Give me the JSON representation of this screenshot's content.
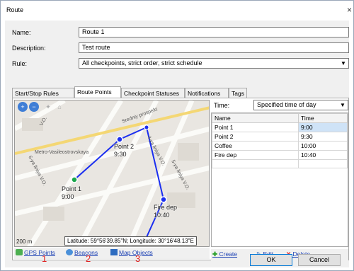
{
  "window": {
    "title": "Route",
    "close": "×"
  },
  "form": {
    "name_label": "Name:",
    "name_value": "Route 1",
    "description_label": "Description:",
    "description_value": "Test route",
    "rule_label": "Rule:",
    "rule_value": "All checkpoints, strict order, strict schedule"
  },
  "tabs": [
    "Start/Stop Rules",
    "Route Points",
    "Checkpoint Statuses",
    "Notifications",
    "Tags"
  ],
  "map": {
    "points": [
      {
        "name": "Point 1",
        "time": "9:00"
      },
      {
        "name": "Point 2",
        "time": "9:30"
      },
      {
        "name": "Fire dep",
        "time": "10:40"
      }
    ],
    "street_labels": [
      "Metro-Vasileostrovskaya",
      "Sredniy prospekt",
      "4-ya liniya V.O.",
      "5-ya liniya V.O.",
      "V.O.",
      "6-ya liniya V.O."
    ],
    "scale": "200 m",
    "tooltip": "Latitude: 59°56'39.85\"N; Longitude: 30°16'48.13\"E"
  },
  "map_links": {
    "gps": "GPS Points",
    "beacons": "Beacons",
    "map_objects": "Map Objects"
  },
  "time_filter": {
    "label": "Time:",
    "value": "Specified time of day"
  },
  "grid": {
    "headers": [
      "Name",
      "Time"
    ],
    "rows": [
      [
        "Point 1",
        "9:00"
      ],
      [
        "Point 2",
        "9:30"
      ],
      [
        "Coffee",
        "10:00"
      ],
      [
        "Fire dep",
        "10:40"
      ]
    ]
  },
  "actions": {
    "create": "Create",
    "edit": "Edit",
    "delete": "Delete"
  },
  "annotations": [
    "1",
    "2",
    "3"
  ],
  "buttons": {
    "ok": "OK",
    "cancel": "Cancel"
  }
}
